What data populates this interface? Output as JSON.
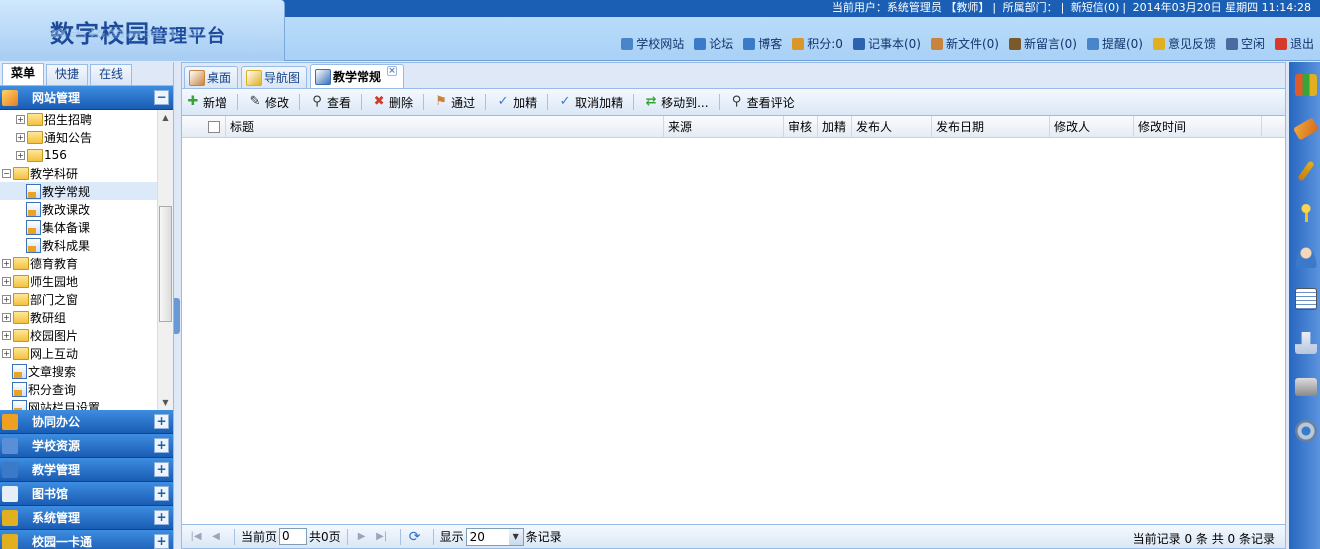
{
  "app": {
    "title_main": "数字校园",
    "title_sub": "管理平台",
    "title_shadow": "数字校园管理平台"
  },
  "userinfo": {
    "current_user": "当前用户：系统管理员 【教师】",
    "department": "所属部门：",
    "sms": "新短信(0)",
    "datetime": "2014年03月20日 星期四 11:14:28"
  },
  "toplinks": [
    {
      "label": "学校网站",
      "icon": "globe-icon",
      "color": "#4a84c9"
    },
    {
      "label": "论坛",
      "icon": "forum-icon",
      "color": "#3a7ac9"
    },
    {
      "label": "博客",
      "icon": "blog-icon",
      "color": "#3a7ac9"
    },
    {
      "label": "积分:0",
      "icon": "chart-icon",
      "color": "#d9962a"
    },
    {
      "label": "记事本(0)",
      "icon": "notebook-icon",
      "color": "#2d62b0"
    },
    {
      "label": "新文件(0)",
      "icon": "file-icon",
      "color": "#c8843c"
    },
    {
      "label": "新留言(0)",
      "icon": "message-icon",
      "color": "#7a5a2a"
    },
    {
      "label": "提醒(0)",
      "icon": "info-icon",
      "color": "#4a84c9"
    },
    {
      "label": "意见反馈",
      "icon": "feedback-icon",
      "color": "#e0b020"
    },
    {
      "label": "空闲",
      "icon": "user-status-icon",
      "color": "#4a6aa0"
    },
    {
      "label": "退出",
      "icon": "logout-icon",
      "color": "#d63a2a"
    }
  ],
  "left": {
    "tabs": [
      "菜单",
      "快捷",
      "在线"
    ],
    "active_section": "网站管理",
    "tree": [
      {
        "label": "招生招聘",
        "type": "folder",
        "indent": 1,
        "toggle": "+"
      },
      {
        "label": "通知公告",
        "type": "folder",
        "indent": 1,
        "toggle": "+"
      },
      {
        "label": "156",
        "type": "folder",
        "indent": 1,
        "toggle": "+"
      },
      {
        "label": "教学科研",
        "type": "folder",
        "indent": 0,
        "toggle": "-"
      },
      {
        "label": "教学常规",
        "type": "doc",
        "indent": 2,
        "selected": true
      },
      {
        "label": "教改课改",
        "type": "doc",
        "indent": 2
      },
      {
        "label": "集体备课",
        "type": "doc",
        "indent": 2
      },
      {
        "label": "教科成果",
        "type": "doc",
        "indent": 2
      },
      {
        "label": "德育教育",
        "type": "folder",
        "indent": 0,
        "toggle": "+"
      },
      {
        "label": "师生园地",
        "type": "folder",
        "indent": 0,
        "toggle": "+"
      },
      {
        "label": "部门之窗",
        "type": "folder",
        "indent": 0,
        "toggle": "+"
      },
      {
        "label": "教研组",
        "type": "folder",
        "indent": 0,
        "toggle": "+"
      },
      {
        "label": "校园图片",
        "type": "folder",
        "indent": 0,
        "toggle": "+"
      },
      {
        "label": "网上互动",
        "type": "folder",
        "indent": 0,
        "toggle": "+"
      },
      {
        "label": "文章搜索",
        "type": "doc",
        "indent": 1
      },
      {
        "label": "积分查询",
        "type": "doc",
        "indent": 1
      },
      {
        "label": "网站栏目设置",
        "type": "doc",
        "indent": 1
      }
    ],
    "sections": [
      "协同办公",
      "学校资源",
      "教学管理",
      "图书馆",
      "系统管理",
      "校园一卡通"
    ]
  },
  "main": {
    "tabs": [
      {
        "label": "桌面",
        "icon": "home-icon",
        "active": false
      },
      {
        "label": "导航图",
        "icon": "navigation-icon",
        "active": false
      },
      {
        "label": "教学常规",
        "icon": "document-icon",
        "active": true
      }
    ],
    "toolbar": [
      {
        "label": "新增",
        "icon": "add-icon",
        "glyph": "✚",
        "color": "#3aa33a"
      },
      {
        "label": "修改",
        "icon": "edit-icon",
        "glyph": "✎",
        "color": "#333"
      },
      {
        "label": "查看",
        "icon": "view-icon",
        "glyph": "⚲",
        "color": "#333"
      },
      {
        "label": "删除",
        "icon": "delete-icon",
        "glyph": "✖",
        "color": "#d43a2a"
      },
      {
        "label": "通过",
        "icon": "approve-icon",
        "glyph": "⚑",
        "color": "#c8843c"
      },
      {
        "label": "加精",
        "icon": "highlight-icon",
        "glyph": "✓",
        "color": "#3a7ac9"
      },
      {
        "label": "取消加精",
        "icon": "cancel-highlight-icon",
        "glyph": "✓",
        "color": "#3a7ac9"
      },
      {
        "label": "移动到...",
        "icon": "move-icon",
        "glyph": "⇄",
        "color": "#3aa33a"
      },
      {
        "label": "查看评论",
        "icon": "comments-icon",
        "glyph": "⚲",
        "color": "#333"
      }
    ],
    "columns": [
      "标题",
      "来源",
      "审核",
      "加精",
      "发布人",
      "发布日期",
      "修改人",
      "修改时间"
    ],
    "pager": {
      "current_page_label": "当前页",
      "current_page": "0",
      "total_pages": "共0页",
      "show_label": "显示",
      "page_size": "20",
      "records_label": "条记录",
      "summary": "当前记录 0 条 共 0 条记录"
    }
  }
}
